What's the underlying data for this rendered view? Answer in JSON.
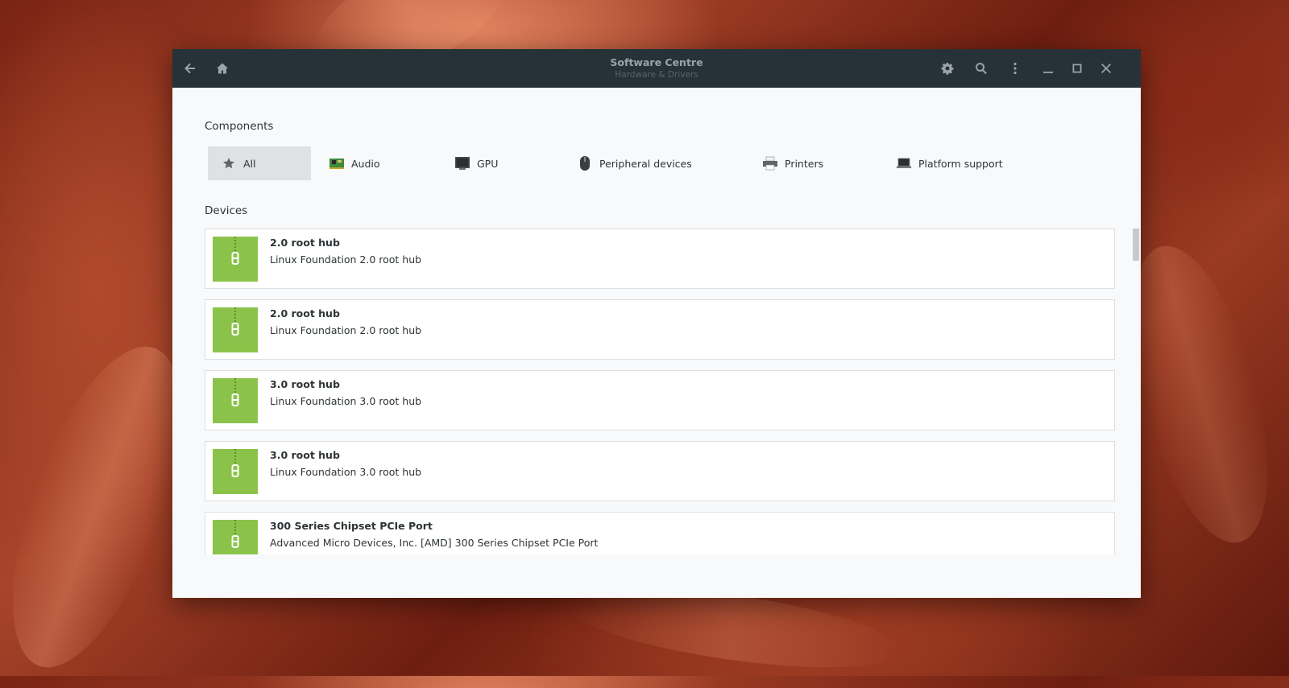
{
  "window": {
    "title": "Software Centre",
    "subtitle": "Hardware & Drivers"
  },
  "titlebar_icons": {
    "back": "back-arrow-icon",
    "home": "home-icon",
    "settings": "gear-icon",
    "search": "search-icon",
    "menu": "kebab-menu-icon",
    "minimize": "minimize-icon",
    "maximize": "maximize-icon",
    "close": "close-icon"
  },
  "components": {
    "heading": "Components",
    "items": [
      {
        "label": "All",
        "icon": "star-icon",
        "active": true
      },
      {
        "label": "Audio",
        "icon": "sound-card-icon",
        "active": false
      },
      {
        "label": "GPU",
        "icon": "monitor-icon",
        "active": false
      },
      {
        "label": "Peripheral devices",
        "icon": "mouse-icon",
        "active": false
      },
      {
        "label": "Printers",
        "icon": "printer-icon",
        "active": false
      },
      {
        "label": "Platform support",
        "icon": "laptop-icon",
        "active": false
      }
    ]
  },
  "devices": {
    "heading": "Devices",
    "items": [
      {
        "name": "2.0 root hub",
        "description": "Linux Foundation 2.0 root hub"
      },
      {
        "name": "2.0 root hub",
        "description": "Linux Foundation 2.0 root hub"
      },
      {
        "name": "3.0 root hub",
        "description": "Linux Foundation 3.0 root hub"
      },
      {
        "name": "3.0 root hub",
        "description": "Linux Foundation 3.0 root hub"
      },
      {
        "name": "300 Series Chipset PCIe Port",
        "description": "Advanced Micro Devices, Inc. [AMD] 300 Series Chipset PCIe Port"
      }
    ]
  },
  "colors": {
    "titlebar": "#263238",
    "package_icon": "#8bc34a",
    "active_category": "#dfe1e3"
  }
}
